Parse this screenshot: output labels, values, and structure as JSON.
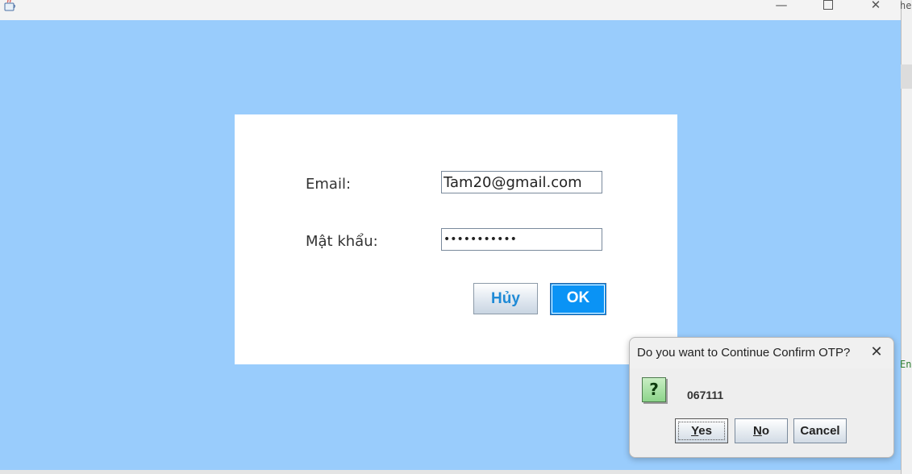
{
  "window": {
    "controls": {
      "minimize": "—",
      "maximize": "",
      "close": "✕"
    }
  },
  "background": {
    "fragment_top": "he",
    "fragment_mid": "En"
  },
  "login": {
    "email_label": "Email:",
    "email_value": "Tam20@gmail.com",
    "password_label": "Mật khẩu:",
    "password_mask": "•••••••••••",
    "cancel_label": "Hủy",
    "ok_label": "OK"
  },
  "dialog": {
    "title": "Do you want to Continue Confirm OTP?",
    "close_glyph": "✕",
    "icon_glyph": "?",
    "message": "067111",
    "yes_mnemonic": "Y",
    "yes_rest": "es",
    "no_mnemonic": "N",
    "no_rest": "o",
    "cancel_label": "Cancel"
  },
  "colors": {
    "window_bg": "#99ccfc",
    "ok_button": "#0a93f5",
    "cancel_text": "#1f8ad6"
  },
  "icons": [
    "java-cup-icon",
    "minimize-icon",
    "maximize-icon",
    "close-icon",
    "question-icon"
  ]
}
